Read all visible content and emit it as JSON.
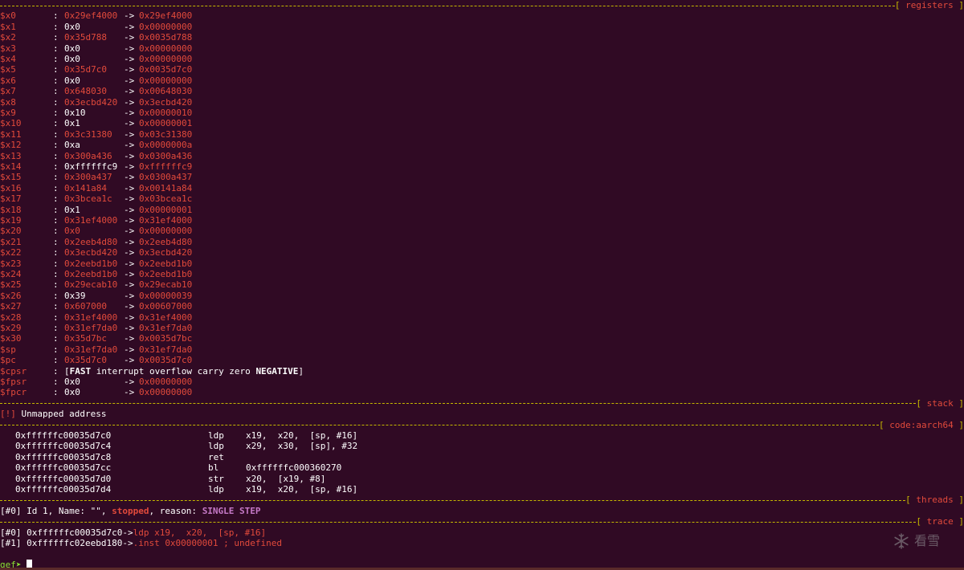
{
  "sections": {
    "registers": "registers",
    "stack": "stack",
    "code": "code:aarch64",
    "threads": "threads",
    "trace": "trace"
  },
  "registers": [
    {
      "name": "$x0",
      "value": "0x29ef4000",
      "deref": "0x29ef4000",
      "changed": true
    },
    {
      "name": "$x1",
      "value": "0x0",
      "deref": "0x00000000",
      "changed": false
    },
    {
      "name": "$x2",
      "value": "0x35d788",
      "deref": "0x0035d788",
      "changed": true
    },
    {
      "name": "$x3",
      "value": "0x0",
      "deref": "0x00000000",
      "changed": false
    },
    {
      "name": "$x4",
      "value": "0x0",
      "deref": "0x00000000",
      "changed": false
    },
    {
      "name": "$x5",
      "value": "0x35d7c0",
      "deref": "0x0035d7c0",
      "changed": true
    },
    {
      "name": "$x6",
      "value": "0x0",
      "deref": "0x00000000",
      "changed": false
    },
    {
      "name": "$x7",
      "value": "0x648030",
      "deref": "0x00648030",
      "changed": true
    },
    {
      "name": "$x8",
      "value": "0x3ecbd420",
      "deref": "0x3ecbd420",
      "changed": true
    },
    {
      "name": "$x9",
      "value": "0x10",
      "deref": "0x00000010",
      "changed": false
    },
    {
      "name": "$x10",
      "value": "0x1",
      "deref": "0x00000001",
      "changed": false
    },
    {
      "name": "$x11",
      "value": "0x3c31380",
      "deref": "0x03c31380",
      "changed": true
    },
    {
      "name": "$x12",
      "value": "0xa",
      "deref": "0x0000000a",
      "changed": false
    },
    {
      "name": "$x13",
      "value": "0x300a436",
      "deref": "0x0300a436",
      "changed": true
    },
    {
      "name": "$x14",
      "value": "0xffffffc9",
      "deref": "0xffffffc9",
      "changed": false
    },
    {
      "name": "$x15",
      "value": "0x300a437",
      "deref": "0x0300a437",
      "changed": true
    },
    {
      "name": "$x16",
      "value": "0x141a84",
      "deref": "0x00141a84",
      "changed": true
    },
    {
      "name": "$x17",
      "value": "0x3bcea1c",
      "deref": "0x03bcea1c",
      "changed": true
    },
    {
      "name": "$x18",
      "value": "0x1",
      "deref": "0x00000001",
      "changed": false
    },
    {
      "name": "$x19",
      "value": "0x31ef4000",
      "deref": "0x31ef4000",
      "changed": true
    },
    {
      "name": "$x20",
      "value": "0x0",
      "deref": "0x00000000",
      "changed": true
    },
    {
      "name": "$x21",
      "value": "0x2eeb4d80",
      "deref": "0x2eeb4d80",
      "changed": true
    },
    {
      "name": "$x22",
      "value": "0x3ecbd420",
      "deref": "0x3ecbd420",
      "changed": true
    },
    {
      "name": "$x23",
      "value": "0x2eebd1b0",
      "deref": "0x2eebd1b0",
      "changed": true
    },
    {
      "name": "$x24",
      "value": "0x2eebd1b0",
      "deref": "0x2eebd1b0",
      "changed": true
    },
    {
      "name": "$x25",
      "value": "0x29ecab10",
      "deref": "0x29ecab10",
      "changed": true
    },
    {
      "name": "$x26",
      "value": "0x39",
      "deref": "0x00000039",
      "changed": false
    },
    {
      "name": "$x27",
      "value": "0x607000",
      "deref": "0x00607000",
      "changed": true
    },
    {
      "name": "$x28",
      "value": "0x31ef4000",
      "deref": "0x31ef4000",
      "changed": true
    },
    {
      "name": "$x29",
      "value": "0x31ef7da0",
      "deref": "0x31ef7da0",
      "changed": true
    },
    {
      "name": "$x30",
      "value": "0x35d7bc",
      "deref": "0x0035d7bc",
      "changed": true
    },
    {
      "name": "$sp",
      "value": "0x31ef7da0",
      "deref": "0x31ef7da0",
      "changed": true
    },
    {
      "name": "$pc",
      "value": "0x35d7c0",
      "deref": "0x0035d7c0",
      "changed": true
    }
  ],
  "cpsr": {
    "name": "$cpsr",
    "open": "[",
    "fast": "FAST",
    "rest": " interrupt overflow carry zero ",
    "negative": "NEGATIVE",
    "close": "]"
  },
  "fpregs": [
    {
      "name": "$fpsr",
      "value": "0x0",
      "deref": "0x00000000"
    },
    {
      "name": "$fpcr",
      "value": "0x0",
      "deref": "0x00000000"
    }
  ],
  "colon": ":",
  "arrow": "->",
  "stack": {
    "tag": "[!]",
    "message": " Unmapped address"
  },
  "code": [
    {
      "addr": "0xffffffc00035d7c0",
      "mnem": "ldp",
      "ops": "x19,  x20,  [sp, #16]"
    },
    {
      "addr": "0xffffffc00035d7c4",
      "mnem": "ldp",
      "ops": "x29,  x30,  [sp], #32"
    },
    {
      "addr": "0xffffffc00035d7c8",
      "mnem": "ret",
      "ops": ""
    },
    {
      "addr": "0xffffffc00035d7cc",
      "mnem": "bl",
      "ops": "0xffffffc000360270"
    },
    {
      "addr": "0xffffffc00035d7d0",
      "mnem": "str",
      "ops": "x20,  [x19, #8]"
    },
    {
      "addr": "0xffffffc00035d7d4",
      "mnem": "ldp",
      "ops": "x19,  x20,  [sp, #16]"
    }
  ],
  "threads": {
    "idx": "[#0]",
    "text1": " Id 1, Name: \"\", ",
    "status": "stopped",
    "text2": ", reason: ",
    "reason": "SINGLE STEP"
  },
  "trace": [
    {
      "idx": "[#0]",
      "addr": " 0xffffffc00035d7c0->",
      "insn": "ldp x19,  x20,  [sp, #16]"
    },
    {
      "idx": "[#1]",
      "addr": " 0xffffffc02eebd180->",
      "insn": ".inst 0x00000001 ; undefined"
    }
  ],
  "prompt": "gef➤ ",
  "watermark": "看雪",
  "colors": {
    "background": "#300a24",
    "separator": "#c5b800",
    "changed_register": "#e24a3b",
    "reason": "#c67ac8",
    "prompt": "#8ae234"
  }
}
